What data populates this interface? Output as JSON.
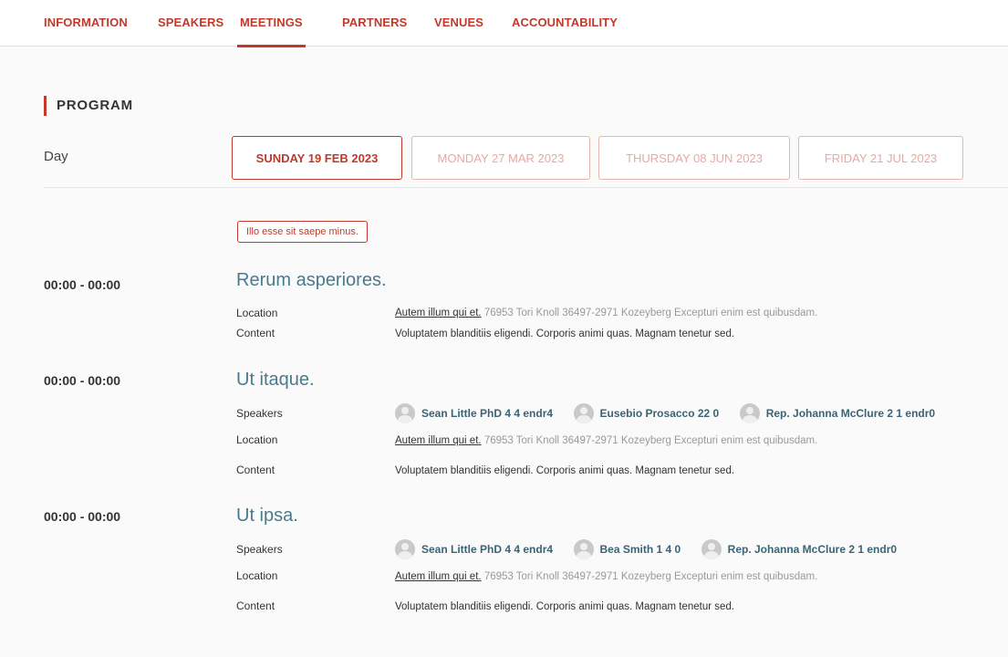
{
  "nav": {
    "tabs": [
      {
        "label": "INFORMATION"
      },
      {
        "label": "SPEAKERS"
      },
      {
        "label": "MEETINGS",
        "active": true
      },
      {
        "label": "PARTNERS"
      },
      {
        "label": "VENUES"
      },
      {
        "label": "ACCOUNTABILITY"
      }
    ]
  },
  "program": {
    "title": "PROGRAM",
    "day_label": "Day",
    "days": [
      "SUNDAY 19 FEB 2023",
      "MONDAY 27 MAR 2023",
      "THURSDAY 08 JUN 2023",
      "FRIDAY 21 JUL 2023"
    ],
    "selected_day": "SUNDAY 19 FEB 2023",
    "tag": "Illo esse sit saepe minus."
  },
  "labels": {
    "speakers": "Speakers",
    "location": "Location",
    "content": "Content"
  },
  "events": [
    {
      "time": "00:00 - 00:00",
      "title": "Rerum asperiores.",
      "location_link": "Autem illum qui et.",
      "location_address": "76953 Tori Knoll 36497-2971 Kozeyberg  Excepturi enim est quibusdam.",
      "content": "Voluptatem blanditiis eligendi. Corporis animi quas. Magnam tenetur sed."
    },
    {
      "time": "00:00 - 00:00",
      "title": "Ut itaque.",
      "speakers": [
        "Sean Little PhD 4 4 endr4",
        "Eusebio Prosacco 22 0",
        "Rep. Johanna McClure 2 1 endr0"
      ],
      "location_link": "Autem illum qui et.",
      "location_address": "76953 Tori Knoll 36497-2971 Kozeyberg  Excepturi enim est quibusdam.",
      "content": "Voluptatem blanditiis eligendi. Corporis animi quas. Magnam tenetur sed."
    },
    {
      "time": "00:00 - 00:00",
      "title": "Ut ipsa.",
      "speakers": [
        "Sean Little PhD 4 4 endr4",
        "Bea Smith 1 4 0",
        "Rep. Johanna McClure 2 1 endr0"
      ],
      "location_link": "Autem illum qui et.",
      "location_address": "76953 Tori Knoll 36497-2971 Kozeyberg  Excepturi enim est quibusdam.",
      "content": "Voluptatem blanditiis eligendi. Corporis animi quas. Magnam tenetur sed."
    }
  ],
  "colors": {
    "accent": "#c0392b",
    "accent_light": "#e8a9a1",
    "event_title": "#4a7a8c",
    "speaker_name": "#3a6475"
  }
}
